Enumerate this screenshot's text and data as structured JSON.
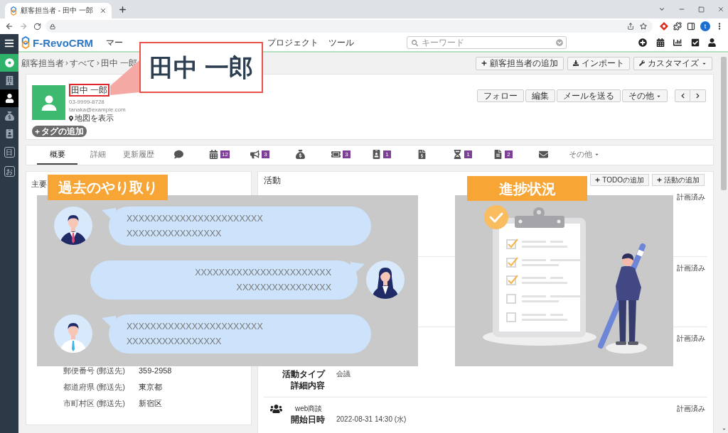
{
  "browser": {
    "tab_title": "顧客担当者 - 田中 一郎",
    "profile_initial": "t"
  },
  "app_header": {
    "logo": "F-RevoCRM",
    "menu": [
      "マー",
      "プロジェクト",
      "ツール"
    ],
    "search": {
      "placeholder": "キーワード"
    }
  },
  "sidebar": {
    "items": [
      {
        "kind": "accent",
        "selected": false
      },
      {
        "kind": "icon",
        "selected": false
      },
      {
        "kind": "icon",
        "selected": true
      },
      {
        "kind": "icon",
        "selected": false
      },
      {
        "kind": "icon",
        "selected": false
      },
      {
        "kind": "letter",
        "label": "日",
        "selected": false
      },
      {
        "kind": "letter",
        "label": "お",
        "selected": false
      }
    ]
  },
  "breadcrumb": [
    "顧客担当者",
    "すべて",
    "田中 一郎"
  ],
  "page_actions": [
    {
      "label": "顧客担当者の追加",
      "dropdown": false
    },
    {
      "label": "インポート",
      "dropdown": false
    },
    {
      "label": "カスタマイズ",
      "dropdown": true
    }
  ],
  "record": {
    "name": "田中 一郎",
    "phone": "03-9999-8728",
    "email": "tanaka@example.com",
    "map_link": "地図を表示",
    "tag_button": "タグの追加",
    "actions": [
      {
        "label": "フォロー",
        "dropdown": false
      },
      {
        "label": "編集",
        "dropdown": false
      },
      {
        "label": "メールを送る",
        "dropdown": false
      },
      {
        "label": "その他",
        "dropdown": true
      }
    ]
  },
  "record_tabs": [
    {
      "kind": "text",
      "label": "概要",
      "selected": true
    },
    {
      "kind": "text",
      "label": "詳細",
      "selected": false
    },
    {
      "kind": "text",
      "label": "更新履歴",
      "selected": false
    },
    {
      "kind": "icon",
      "selected": false
    },
    {
      "kind": "icon",
      "badge": "12",
      "selected": false
    },
    {
      "kind": "icon",
      "badge": "3",
      "selected": false
    },
    {
      "kind": "icon",
      "selected": false
    },
    {
      "kind": "icon",
      "badge": "3",
      "selected": false
    },
    {
      "kind": "icon",
      "badge": "1",
      "selected": false
    },
    {
      "kind": "icon",
      "selected": false
    },
    {
      "kind": "icon",
      "badge": "1",
      "selected": false
    },
    {
      "kind": "icon",
      "badge": "2",
      "selected": false
    },
    {
      "kind": "icon",
      "selected": false
    },
    {
      "kind": "text",
      "label": "その他",
      "dropdown": true,
      "selected": false
    }
  ],
  "summary_panel": {
    "title": "主要",
    "fields": [
      {
        "label": "郵便番号 (郵送先)",
        "value": "359-2958"
      },
      {
        "label": "都道府県 (郵送先)",
        "value": "東京都"
      },
      {
        "label": "市町村区 (郵送先)",
        "value": "新宿区"
      }
    ]
  },
  "activity_panel": {
    "title": "活動",
    "buttons": [
      "TODOの追加",
      "活動の追加"
    ],
    "items": [
      {
        "status": "計画済み"
      },
      {
        "status": "計画済み"
      },
      {
        "status": "計画済み",
        "fields": [
          {
            "label": "活動タイプ",
            "value": "会議"
          },
          {
            "label": "詳細内容"
          }
        ]
      },
      {
        "title": "web商談",
        "status": "計画済み",
        "fields": [
          {
            "label": "開始日時",
            "value": "2022-08-31 14:30 (水)"
          }
        ]
      }
    ]
  },
  "overlays": {
    "callout": {
      "text": "田中 一郎"
    },
    "history": {
      "label": "過去のやり取り",
      "messages": [
        {
          "kind": "received",
          "lines": [
            "XXXXXXXXXXXXXXXXXXXXXXX",
            "XXXXXXXXXXXXXXXX"
          ]
        },
        {
          "kind": "sent",
          "lines": [
            "XXXXXXXXXXXXXXXXXXXXXXX",
            "XXXXXXXXXXXXXXXX"
          ]
        },
        {
          "kind": "received",
          "lines": [
            "XXXXXXXXXXXXXXXXXXXXXXX",
            "XXXXXXXXXXXXXXXX"
          ]
        }
      ]
    },
    "progress": {
      "label": "進捗状況"
    }
  }
}
